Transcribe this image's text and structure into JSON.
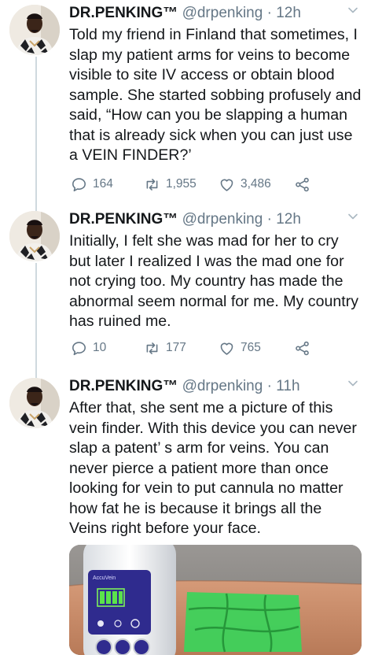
{
  "tweets": [
    {
      "name": "DR.PENKING™",
      "handle": "@drpenking",
      "dot": "·",
      "time": "12h",
      "text": "Told my friend in Finland that sometimes, I slap my patient arms for veins to become visible to site IV access or obtain blood sample. She started sobbing profusely and said, “How can you be slapping a human that is already sick when you can just use a VEIN FINDER?’",
      "replies": "164",
      "retweets": "1,955",
      "likes": "3,486"
    },
    {
      "name": "DR.PENKING™",
      "handle": "@drpenking",
      "dot": "·",
      "time": "12h",
      "text": "Initially, I felt she was mad for her to cry but later I realized I was the mad one for not crying too. My country has made the abnormal seem normal for me. My country has ruined me.",
      "replies": "10",
      "retweets": "177",
      "likes": "765"
    },
    {
      "name": "DR.PENKING™",
      "handle": "@drpenking",
      "dot": "·",
      "time": "11h",
      "text": "After that, she sent me a picture of this vein finder. With this device you can never slap a patent’ s arm for veins. You can never pierce a patient more than once looking for vein to put cannula no matter how fat he is because it brings all the Veins right before your face."
    }
  ],
  "media": {
    "device_label": "AccuVein"
  },
  "colors": {
    "text": "#14171a",
    "secondary": "#657786",
    "thread_line": "#cfd9de"
  },
  "icons": [
    "reply-icon",
    "retweet-icon",
    "like-icon",
    "share-icon",
    "chevron-down-icon"
  ]
}
